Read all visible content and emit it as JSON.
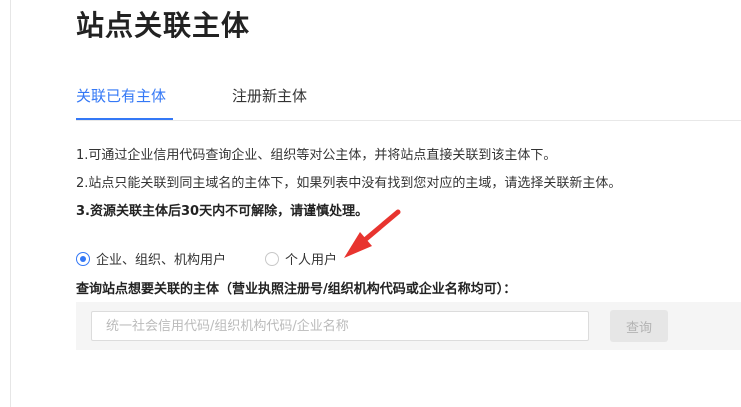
{
  "page": {
    "title": "站点关联主体"
  },
  "tabs": [
    {
      "label": "关联已有主体",
      "active": true
    },
    {
      "label": "注册新主体",
      "active": false
    }
  ],
  "notices": [
    "1.可通过企业信用代码查询企业、组织等对公主体，并将站点直接关联到该主体下。",
    "2.站点只能关联到同主域名的主体下，如果列表中没有找到您对应的主域，请选择关联新主体。",
    "3.资源关联主体后30天内不可解除，请谨慎处理。"
  ],
  "user_type": {
    "options": [
      {
        "label": "企业、组织、机构用户",
        "checked": true
      },
      {
        "label": "个人用户",
        "checked": false
      }
    ]
  },
  "query": {
    "label": "查询站点想要关联的主体（营业执照注册号/组织机构代码或企业名称均可）：",
    "placeholder": "统一社会信用代码/组织机构代码/企业名称",
    "value": "",
    "button_label": "查询"
  },
  "colors": {
    "accent": "#3478f6",
    "annotation_arrow": "#e8342f"
  },
  "icons": {
    "annotation": "red-arrow-icon"
  }
}
